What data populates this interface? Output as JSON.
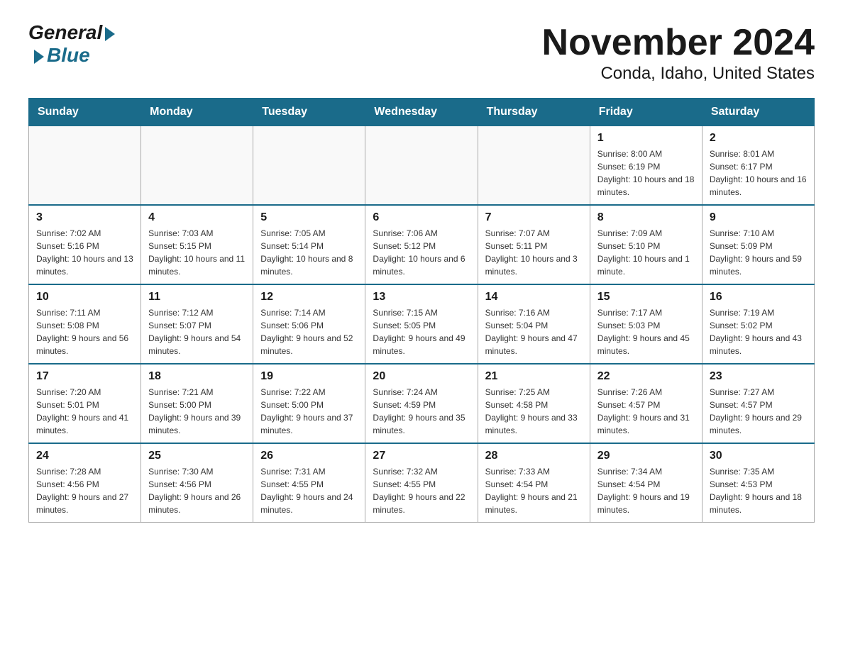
{
  "logo": {
    "general": "General",
    "blue": "Blue"
  },
  "title": "November 2024",
  "location": "Conda, Idaho, United States",
  "days_of_week": [
    "Sunday",
    "Monday",
    "Tuesday",
    "Wednesday",
    "Thursday",
    "Friday",
    "Saturday"
  ],
  "weeks": [
    [
      {
        "day": "",
        "sunrise": "",
        "sunset": "",
        "daylight": ""
      },
      {
        "day": "",
        "sunrise": "",
        "sunset": "",
        "daylight": ""
      },
      {
        "day": "",
        "sunrise": "",
        "sunset": "",
        "daylight": ""
      },
      {
        "day": "",
        "sunrise": "",
        "sunset": "",
        "daylight": ""
      },
      {
        "day": "",
        "sunrise": "",
        "sunset": "",
        "daylight": ""
      },
      {
        "day": "1",
        "sunrise": "Sunrise: 8:00 AM",
        "sunset": "Sunset: 6:19 PM",
        "daylight": "Daylight: 10 hours and 18 minutes."
      },
      {
        "day": "2",
        "sunrise": "Sunrise: 8:01 AM",
        "sunset": "Sunset: 6:17 PM",
        "daylight": "Daylight: 10 hours and 16 minutes."
      }
    ],
    [
      {
        "day": "3",
        "sunrise": "Sunrise: 7:02 AM",
        "sunset": "Sunset: 5:16 PM",
        "daylight": "Daylight: 10 hours and 13 minutes."
      },
      {
        "day": "4",
        "sunrise": "Sunrise: 7:03 AM",
        "sunset": "Sunset: 5:15 PM",
        "daylight": "Daylight: 10 hours and 11 minutes."
      },
      {
        "day": "5",
        "sunrise": "Sunrise: 7:05 AM",
        "sunset": "Sunset: 5:14 PM",
        "daylight": "Daylight: 10 hours and 8 minutes."
      },
      {
        "day": "6",
        "sunrise": "Sunrise: 7:06 AM",
        "sunset": "Sunset: 5:12 PM",
        "daylight": "Daylight: 10 hours and 6 minutes."
      },
      {
        "day": "7",
        "sunrise": "Sunrise: 7:07 AM",
        "sunset": "Sunset: 5:11 PM",
        "daylight": "Daylight: 10 hours and 3 minutes."
      },
      {
        "day": "8",
        "sunrise": "Sunrise: 7:09 AM",
        "sunset": "Sunset: 5:10 PM",
        "daylight": "Daylight: 10 hours and 1 minute."
      },
      {
        "day": "9",
        "sunrise": "Sunrise: 7:10 AM",
        "sunset": "Sunset: 5:09 PM",
        "daylight": "Daylight: 9 hours and 59 minutes."
      }
    ],
    [
      {
        "day": "10",
        "sunrise": "Sunrise: 7:11 AM",
        "sunset": "Sunset: 5:08 PM",
        "daylight": "Daylight: 9 hours and 56 minutes."
      },
      {
        "day": "11",
        "sunrise": "Sunrise: 7:12 AM",
        "sunset": "Sunset: 5:07 PM",
        "daylight": "Daylight: 9 hours and 54 minutes."
      },
      {
        "day": "12",
        "sunrise": "Sunrise: 7:14 AM",
        "sunset": "Sunset: 5:06 PM",
        "daylight": "Daylight: 9 hours and 52 minutes."
      },
      {
        "day": "13",
        "sunrise": "Sunrise: 7:15 AM",
        "sunset": "Sunset: 5:05 PM",
        "daylight": "Daylight: 9 hours and 49 minutes."
      },
      {
        "day": "14",
        "sunrise": "Sunrise: 7:16 AM",
        "sunset": "Sunset: 5:04 PM",
        "daylight": "Daylight: 9 hours and 47 minutes."
      },
      {
        "day": "15",
        "sunrise": "Sunrise: 7:17 AM",
        "sunset": "Sunset: 5:03 PM",
        "daylight": "Daylight: 9 hours and 45 minutes."
      },
      {
        "day": "16",
        "sunrise": "Sunrise: 7:19 AM",
        "sunset": "Sunset: 5:02 PM",
        "daylight": "Daylight: 9 hours and 43 minutes."
      }
    ],
    [
      {
        "day": "17",
        "sunrise": "Sunrise: 7:20 AM",
        "sunset": "Sunset: 5:01 PM",
        "daylight": "Daylight: 9 hours and 41 minutes."
      },
      {
        "day": "18",
        "sunrise": "Sunrise: 7:21 AM",
        "sunset": "Sunset: 5:00 PM",
        "daylight": "Daylight: 9 hours and 39 minutes."
      },
      {
        "day": "19",
        "sunrise": "Sunrise: 7:22 AM",
        "sunset": "Sunset: 5:00 PM",
        "daylight": "Daylight: 9 hours and 37 minutes."
      },
      {
        "day": "20",
        "sunrise": "Sunrise: 7:24 AM",
        "sunset": "Sunset: 4:59 PM",
        "daylight": "Daylight: 9 hours and 35 minutes."
      },
      {
        "day": "21",
        "sunrise": "Sunrise: 7:25 AM",
        "sunset": "Sunset: 4:58 PM",
        "daylight": "Daylight: 9 hours and 33 minutes."
      },
      {
        "day": "22",
        "sunrise": "Sunrise: 7:26 AM",
        "sunset": "Sunset: 4:57 PM",
        "daylight": "Daylight: 9 hours and 31 minutes."
      },
      {
        "day": "23",
        "sunrise": "Sunrise: 7:27 AM",
        "sunset": "Sunset: 4:57 PM",
        "daylight": "Daylight: 9 hours and 29 minutes."
      }
    ],
    [
      {
        "day": "24",
        "sunrise": "Sunrise: 7:28 AM",
        "sunset": "Sunset: 4:56 PM",
        "daylight": "Daylight: 9 hours and 27 minutes."
      },
      {
        "day": "25",
        "sunrise": "Sunrise: 7:30 AM",
        "sunset": "Sunset: 4:56 PM",
        "daylight": "Daylight: 9 hours and 26 minutes."
      },
      {
        "day": "26",
        "sunrise": "Sunrise: 7:31 AM",
        "sunset": "Sunset: 4:55 PM",
        "daylight": "Daylight: 9 hours and 24 minutes."
      },
      {
        "day": "27",
        "sunrise": "Sunrise: 7:32 AM",
        "sunset": "Sunset: 4:55 PM",
        "daylight": "Daylight: 9 hours and 22 minutes."
      },
      {
        "day": "28",
        "sunrise": "Sunrise: 7:33 AM",
        "sunset": "Sunset: 4:54 PM",
        "daylight": "Daylight: 9 hours and 21 minutes."
      },
      {
        "day": "29",
        "sunrise": "Sunrise: 7:34 AM",
        "sunset": "Sunset: 4:54 PM",
        "daylight": "Daylight: 9 hours and 19 minutes."
      },
      {
        "day": "30",
        "sunrise": "Sunrise: 7:35 AM",
        "sunset": "Sunset: 4:53 PM",
        "daylight": "Daylight: 9 hours and 18 minutes."
      }
    ]
  ]
}
